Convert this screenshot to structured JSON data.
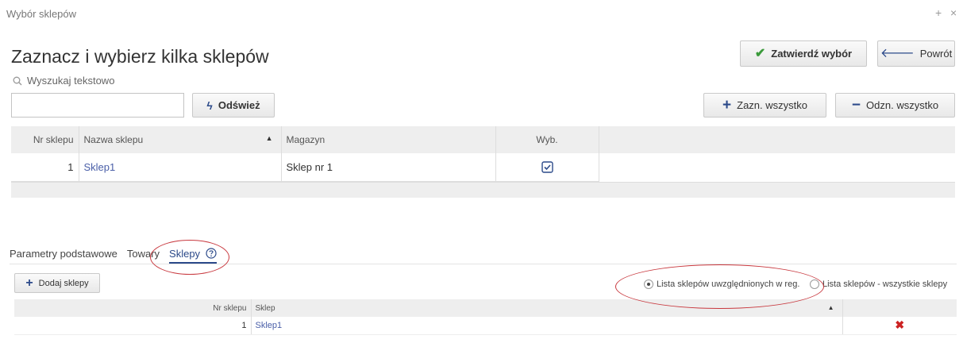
{
  "window": {
    "title": "Wybór sklepów",
    "add_symbol": "+",
    "close_symbol": "×"
  },
  "header": {
    "title": "Zaznacz i wybierz kilka sklepów"
  },
  "actions": {
    "confirm_label": "Zatwierdź wybór",
    "back_label": "Powrót"
  },
  "search": {
    "label": "Wyszukaj tekstowo",
    "value": "",
    "placeholder": "",
    "refresh_label": "Odśwież"
  },
  "selection": {
    "select_all_label": "Zazn. wszystko",
    "deselect_all_label": "Odzn. wszystko"
  },
  "shops_table": {
    "columns": [
      "Nr sklepu",
      "Nazwa sklepu",
      "Magazyn",
      "Wyb."
    ],
    "sort_indicator": "▲",
    "rows": [
      {
        "nr": "1",
        "name": "Sklep1",
        "warehouse": "Sklep nr 1",
        "selected": true
      }
    ]
  },
  "tabs": {
    "items": [
      "Parametry podstawowe",
      "Towary",
      "Sklepy"
    ],
    "active": "Sklepy"
  },
  "sub": {
    "add_label": "Dodaj sklepy",
    "radio1_label": "Lista sklepów uwzględnionych w reg.",
    "radio2_label": "Lista sklepów - wszystkie sklepy",
    "columns": [
      "Nr sklepu",
      "Sklep"
    ],
    "sort_indicator": "▲",
    "rows": [
      {
        "nr": "1",
        "name": "Sklep1"
      }
    ]
  },
  "colors": {
    "accent": "#2c4a8a",
    "link": "#4a5fa8",
    "check": "#3a9a3a",
    "delete": "#cc2222",
    "annotation": "#c8383e"
  },
  "icons": [
    "check-icon",
    "back-arrow-icon",
    "search-icon",
    "lightning-icon",
    "plus-icon",
    "minus-icon",
    "help-icon",
    "delete-icon"
  ]
}
